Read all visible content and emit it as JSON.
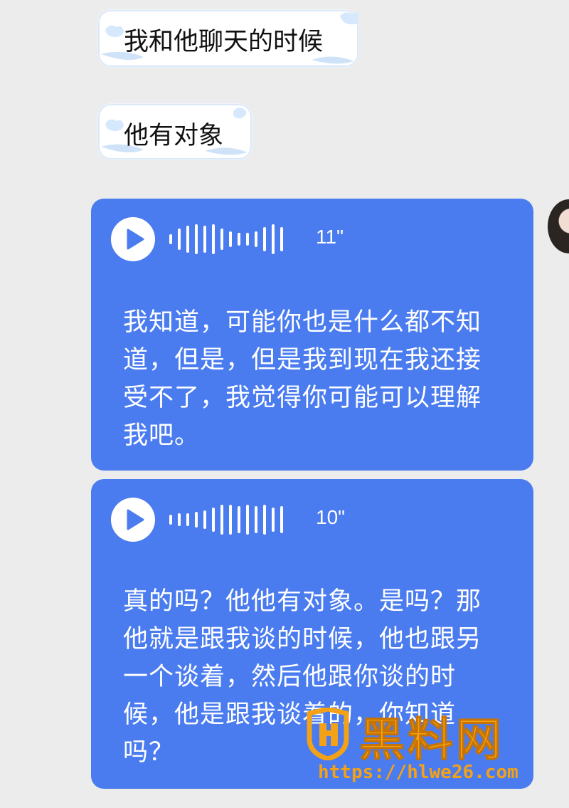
{
  "messages": [
    {
      "type": "text",
      "side": "left",
      "text": "我和他聊天的时候"
    },
    {
      "type": "text",
      "side": "left",
      "text": "他有对象"
    },
    {
      "type": "voice",
      "side": "right",
      "duration": "11\"",
      "transcript": "我知道，可能你也是什么都不知道，但是，但是我到现在我还接受不了，我觉得你可能可以理解我吧。"
    },
    {
      "type": "voice",
      "side": "right",
      "duration": "10\"",
      "transcript": "真的吗？他他有对象。是吗？那他就是跟我谈的时候，他也跟另一个谈着，然后他跟你谈的时候，他是跟我谈着的，你知道吗？"
    }
  ],
  "watermark": {
    "title": "黑料网",
    "url": "https://hlwe26.com"
  },
  "colors": {
    "voice_bubble": "#4a7cf0",
    "background": "#ececec",
    "watermark": "#f3a117"
  },
  "icons": {
    "play": "play-icon",
    "waveform": "waveform-icon"
  }
}
